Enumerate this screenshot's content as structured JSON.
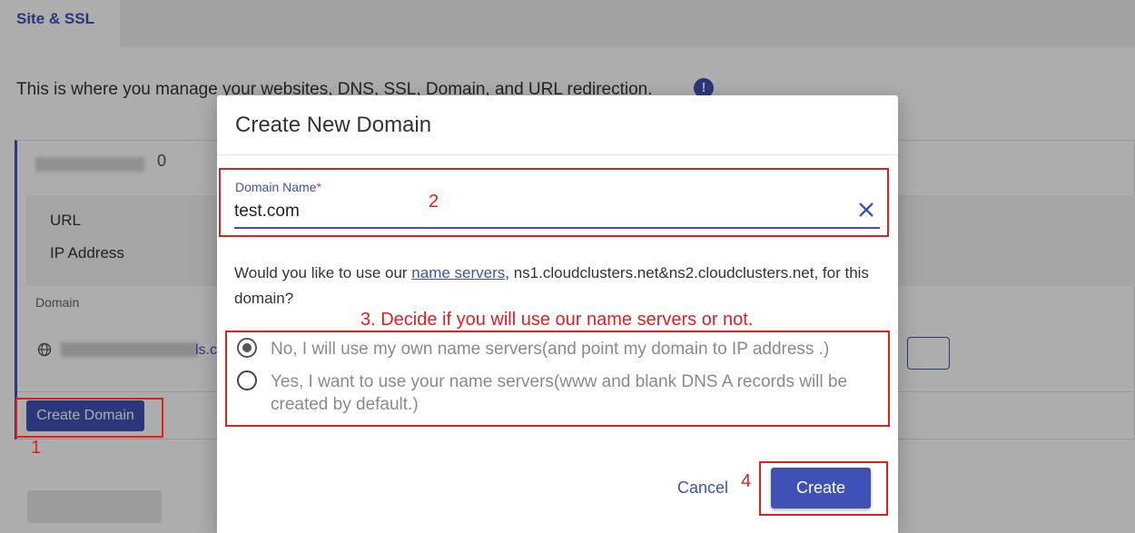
{
  "page": {
    "tab_label": "Site & SSL",
    "intro_text": "This is where you manage your websites, DNS, SSL, Domain, and URL redirection.",
    "site_name_suffix": "0",
    "info_labels": [
      "URL",
      "IP Address"
    ],
    "domain_heading": "Domain",
    "domain_suffix": "ls.c",
    "create_domain_button": "Create Domain"
  },
  "dialog": {
    "title": "Create New Domain",
    "field_label": "Domain Name",
    "required_mark": "*",
    "field_value": "test.com",
    "question_before": "Would you like to use our ",
    "question_link": "name servers",
    "question_after": ", ns1.cloudclusters.net&ns2.cloudclusters.net, for this domain?",
    "options": [
      {
        "label": "No, I will use my own name servers(and point my domain to IP address .)",
        "checked": true
      },
      {
        "label": "Yes, I want to use your name servers(www and blank DNS A records will be created by default.)",
        "checked": false
      }
    ],
    "cancel_label": "Cancel",
    "create_label": "Create"
  },
  "annotations": {
    "step1": "1",
    "step2": "2",
    "step3": "3. Decide if you will use our name servers or not.",
    "step4": "4"
  },
  "colors": {
    "accent": "#3f51b5",
    "annotation": "#e02020",
    "required": "#e53935"
  },
  "icons": [
    "info-icon",
    "globe-icon",
    "close-icon",
    "radio-checked-icon",
    "radio-unchecked-icon"
  ]
}
